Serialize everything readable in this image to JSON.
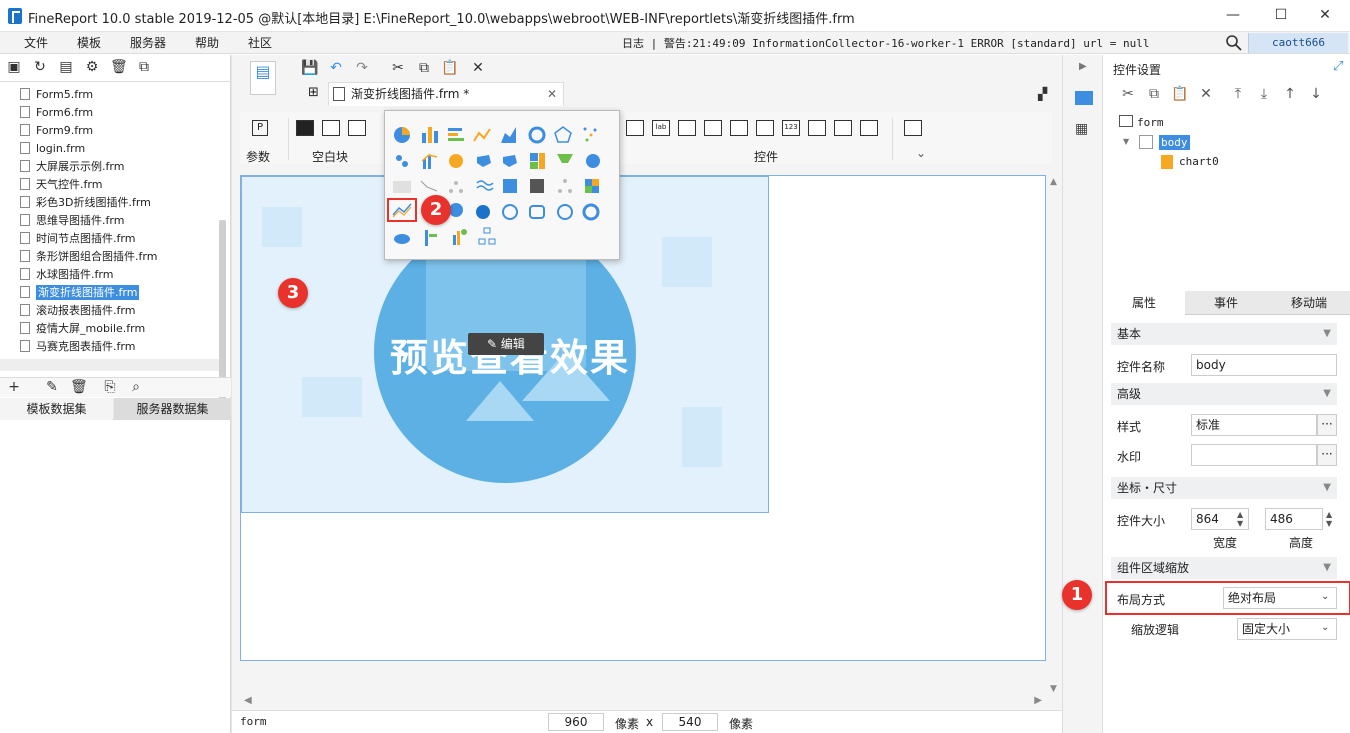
{
  "window": {
    "title": "FineReport 10.0 stable 2019-12-05 @默认[本地目录]    E:\\FineReport_10.0\\webapps\\webroot\\WEB-INF\\reportlets\\渐变折线图插件.frm",
    "minimize": "—",
    "maximize": "☐",
    "close": "✕"
  },
  "menu": [
    "文件",
    "模板",
    "服务器",
    "帮助",
    "社区"
  ],
  "log_text": "日志 | 警告:21:49:09 InformationCollector-16-worker-1 ERROR [standard] url = null",
  "user": "caott666",
  "files": [
    "Form5.frm",
    "Form6.frm",
    "Form9.frm",
    "login.frm",
    "大屏展示示例.frm",
    "天气控件.frm",
    "彩色3D折线图插件.frm",
    "思维导图插件.frm",
    "时间节点图插件.frm",
    "条形饼图组合图插件.frm",
    "水球图插件.frm",
    "渐变折线图插件.frm",
    "滚动报表图插件.frm",
    "疫情大屏_mobile.frm",
    "马赛克图表插件.frm"
  ],
  "selected_file_index": 11,
  "dataset_tabs": [
    "模板数据集",
    "服务器数据集"
  ],
  "editor": {
    "tab_label": "渐变折线图插件.frm *",
    "widget_groups": {
      "params": "参数",
      "blank": "空白块",
      "controls": "控件"
    }
  },
  "canvas": {
    "preview_text": "预览查看效果",
    "edit_label": "编辑"
  },
  "status": {
    "element": "form",
    "width": "960",
    "unit1": "像素",
    "x": "x",
    "height": "540",
    "unit2": "像素"
  },
  "right": {
    "title": "控件设置",
    "tree": {
      "root": "form",
      "body": "body",
      "chart": "chart0"
    },
    "prop_tabs": [
      "属性",
      "事件",
      "移动端"
    ],
    "sections": {
      "basic": "基本",
      "advanced": "高级",
      "coords": "坐标・尺寸",
      "zoom": "组件区域缩放"
    },
    "fields": {
      "name_label": "控件名称",
      "name_value": "body",
      "style_label": "样式",
      "style_value": "标准",
      "watermark_label": "水印",
      "watermark_value": "",
      "size_label": "控件大小",
      "width_value": "864",
      "height_value": "486",
      "width_label": "宽度",
      "height_label": "高度",
      "layout_label": "布局方式",
      "layout_value": "绝对布局",
      "zoom_label": "缩放逻辑",
      "zoom_value": "固定大小"
    }
  },
  "badges": [
    "1",
    "2",
    "3"
  ],
  "colors": {
    "accent": "#3d8ee0",
    "badge": "#e8322b",
    "chart_bg": "#e3f1fc",
    "circle": "#5cb0e4"
  }
}
